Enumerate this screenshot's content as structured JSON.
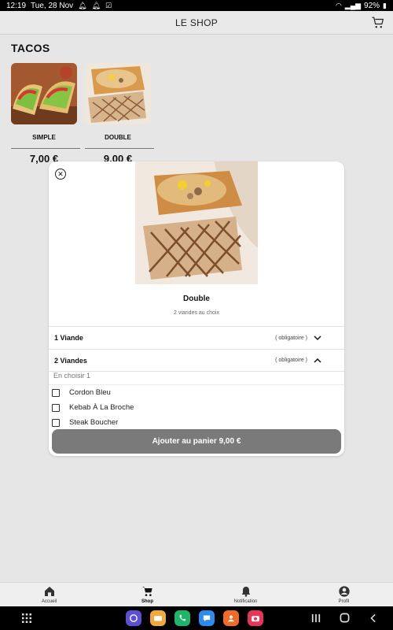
{
  "status": {
    "time": "12:19",
    "date": "Tue, 28 Nov",
    "battery": "92%"
  },
  "appbar": {
    "title": "LE SHOP",
    "cart_icon": "cart-icon"
  },
  "category": {
    "title": "TACOS",
    "products": [
      {
        "name": "SIMPLE",
        "price": "7,00 €"
      },
      {
        "name": "DOUBLE",
        "price": "9,00 €"
      }
    ]
  },
  "modal": {
    "close_icon": "close-icon",
    "product_title": "Double",
    "product_subtitle": "2 viandes au choix",
    "options": [
      {
        "label": "1 Viande",
        "required": "( obligatoire )",
        "state": "collapsed"
      },
      {
        "label": "2 Viandes",
        "required": "( obligatoire )",
        "state": "expanded"
      }
    ],
    "choose_text": "En choisir 1",
    "choices": [
      {
        "label": "Cordon Bleu",
        "checked": false
      },
      {
        "label": "Kebab À La Broche",
        "checked": false
      },
      {
        "label": "Steak Boucher",
        "checked": false
      }
    ],
    "add_button": "Ajouter au panier 9,00 €"
  },
  "bottom_nav": {
    "items": [
      {
        "label": "Accueil",
        "icon": "home-icon"
      },
      {
        "label": "Shop",
        "icon": "cart-icon",
        "active": true
      },
      {
        "label": "Notification",
        "icon": "bell-icon"
      },
      {
        "label": "Profil",
        "icon": "user-icon"
      }
    ]
  },
  "colors": {
    "background": "#e6e6e6",
    "button": "#7a7a7a",
    "modal": "#ffffff"
  }
}
